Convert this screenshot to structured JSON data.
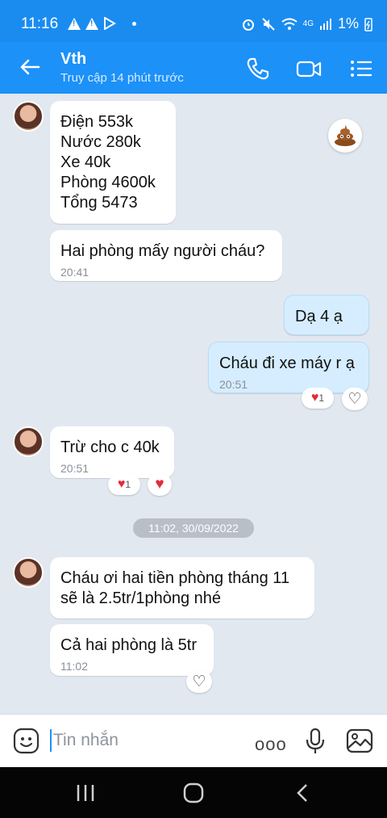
{
  "status_bar": {
    "time": "11:16",
    "network": "4G",
    "battery": "1%"
  },
  "header": {
    "contact_name": "Vth",
    "last_seen": "Truy cập 14 phút trước"
  },
  "messages": [
    {
      "lines": [
        "Điện 553k",
        "Nước 280k",
        "Xe 40k",
        "Phòng 4600k",
        "Tổng 5473"
      ]
    },
    {
      "text": "Hai phòng mấy người cháu?",
      "time": "20:41"
    },
    {
      "text": "Dạ 4 ạ"
    },
    {
      "text": "Cháu đi xe máy r ạ",
      "time": "20:51",
      "reaction_count": "1"
    },
    {
      "text": "Trừ cho c 40k",
      "time": "20:51",
      "reaction_count": "1"
    },
    {
      "text_line1": "Cháu ơi hai tiền phòng tháng 11",
      "text_line2": "sẽ là 2.5tr/1phòng nhé"
    },
    {
      "text": "Cả hai phòng là 5tr",
      "time": "11:02"
    }
  ],
  "date_separator": "11:02, 30/09/2022",
  "input": {
    "placeholder": "Tin nhắn",
    "more_label": "ooo"
  },
  "colors": {
    "header": "#1c91f8",
    "chat_bg": "#e2e8f0",
    "my_bubble": "#d5edff",
    "heart": "#e22b3a"
  }
}
